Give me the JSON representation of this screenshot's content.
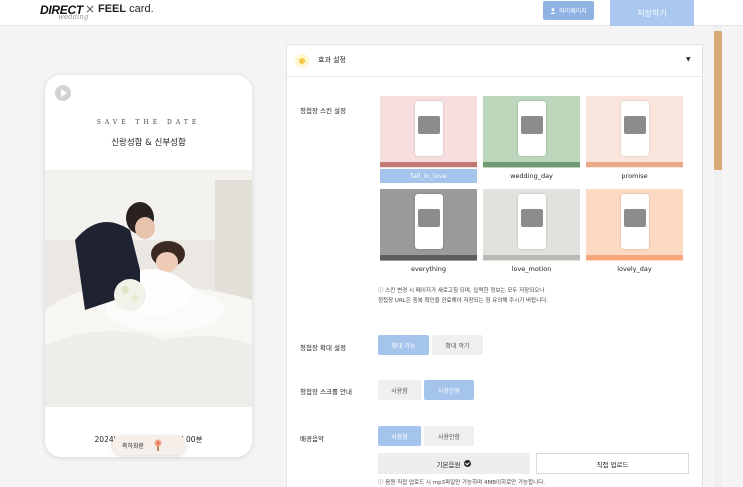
{
  "header": {
    "brand": "DIRECT",
    "brand_sub": "wedding",
    "separator": "×",
    "partner_brand_bold": "FEEL",
    "partner_brand_rest": " card.",
    "mypage_label": "마이페이지",
    "save_label": "저장하기"
  },
  "preview": {
    "tagline": "SAVE THE DATE",
    "names": "신랑성함 & 신부성함",
    "date": "2024년 1월 1일 오후 01시 00분",
    "congrats": "축하화환"
  },
  "panel": {
    "title": "효과 설정",
    "skin_label": "청첩장 스킨 설정",
    "skins": [
      {
        "name": "fall_in_love",
        "selected": true,
        "bg": "#f6dede",
        "strip": "#c17a73"
      },
      {
        "name": "wedding_day",
        "selected": false,
        "bg": "#bcd5bb",
        "strip": "#6f9a73"
      },
      {
        "name": "promise",
        "selected": false,
        "bg": "#fbe6dd",
        "strip": "#e8ab86"
      },
      {
        "name": "everything",
        "selected": false,
        "bg": "#9a9a9a",
        "strip": "#5e5e5e"
      },
      {
        "name": "love_motion",
        "selected": false,
        "bg": "#e3e1de",
        "strip": "#bdbab5"
      },
      {
        "name": "lovely_day",
        "selected": false,
        "bg": "#fdd9c3",
        "strip": "#f6a77b"
      }
    ],
    "skin_note_1": "ⓘ 스킨 변경 시 페이지가 새로고침 되며, 입력한 정보는 모두 저장되오나",
    "skin_note_2": "청첩장 URL은 중복 확인을 완료해야 저장되는 점 유의해 주시기 바랍니다.",
    "zoom_label": "청첩장 확대 설정",
    "zoom_on": "확대 가능",
    "zoom_off": "확대 막기",
    "scroll_label": "청첩장 스크롤 안내",
    "scroll_use": "사용함",
    "scroll_nouse": "사용안함",
    "bgm_label": "배경음악",
    "bgm_use": "사용함",
    "bgm_nouse": "사용안함",
    "bgm_basic": "기본음원",
    "bgm_upload": "직접 업로드",
    "bgm_note": "ⓘ 음원 직접 업로드 시 mp3파일만 가능하며 4MB이하로만 가능합니다."
  },
  "colors": {
    "accent": "#a5c4ec",
    "save_button": "#a9c7ef",
    "scrollbar": "#d9a878"
  }
}
